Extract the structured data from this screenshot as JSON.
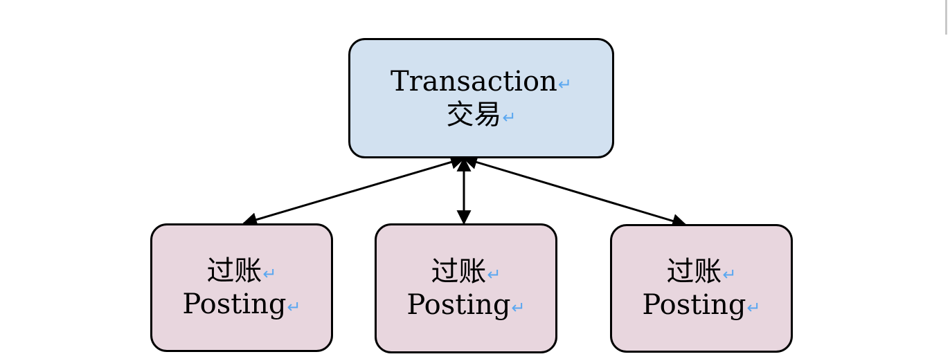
{
  "colors": {
    "transaction_fill": "#d2e1f0",
    "posting_fill": "#e8d6de",
    "border": "#000000",
    "paragraph_mark": "#5aa7f0"
  },
  "icons": {
    "paragraph_mark": "↵"
  },
  "transaction": {
    "label_en": "Transaction",
    "label_zh": "交易"
  },
  "postings": [
    {
      "label_zh": "过账",
      "label_en": "Posting"
    },
    {
      "label_zh": "过账",
      "label_en": "Posting"
    },
    {
      "label_zh": "过账",
      "label_en": "Posting"
    }
  ]
}
